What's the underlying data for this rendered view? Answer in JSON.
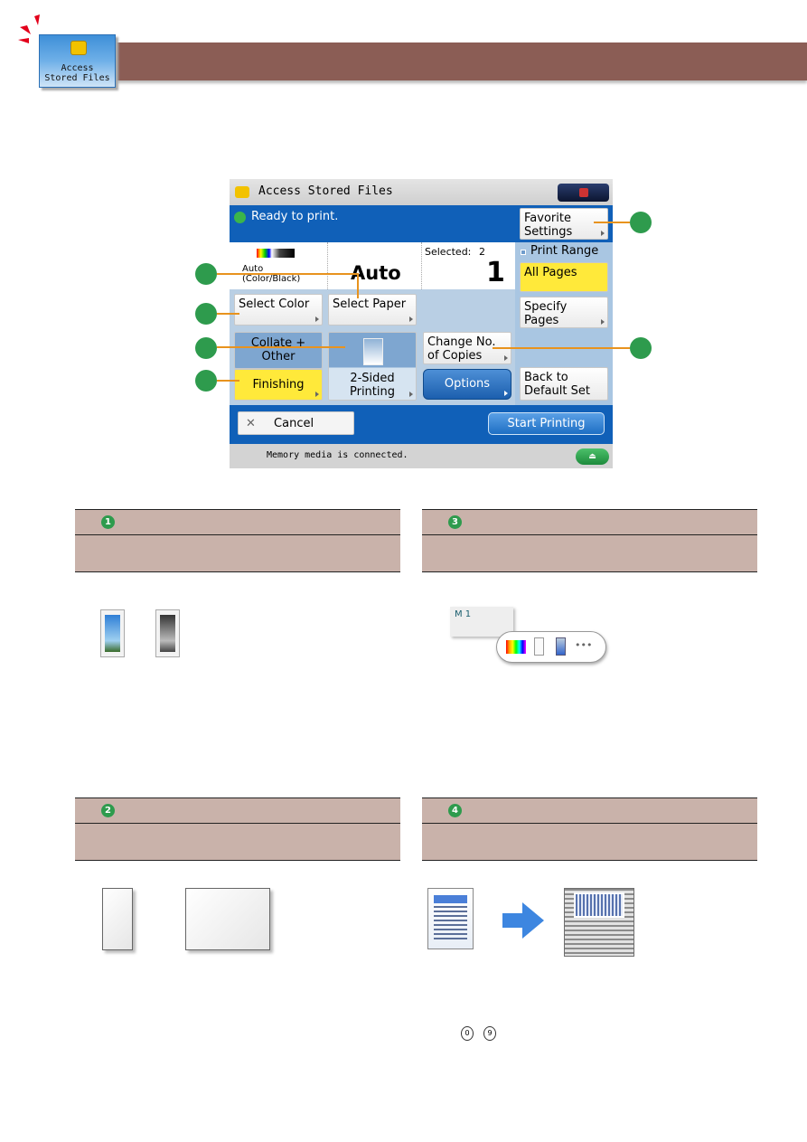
{
  "header": {
    "tile_label_line1": "Access",
    "tile_label_line2": "Stored Files"
  },
  "screen": {
    "title": "Access Stored Files",
    "status": "Ready to print.",
    "favorite_settings": [
      "Favorite",
      "Settings"
    ],
    "color_mode": [
      "Auto",
      "(Color/Black)"
    ],
    "paper": "Auto",
    "selected_label": "Selected:",
    "selected_count": "2",
    "copies": "1",
    "print_range_label": "Print Range",
    "all_pages": "All Pages",
    "specify_pages": [
      "Specify",
      "Pages"
    ],
    "select_color": "Select Color",
    "select_paper": "Select Paper",
    "collate": [
      "Collate +",
      "Other"
    ],
    "finishing": "Finishing",
    "two_sided": [
      "2-Sided",
      "Printing"
    ],
    "change_copies": [
      "Change No.",
      "of Copies"
    ],
    "options": "Options",
    "back_default": [
      "Back to",
      "Default Set"
    ],
    "cancel": "Cancel",
    "start_printing": "Start Printing",
    "footer_status": "Memory media is connected."
  },
  "sections": [
    {
      "num": "1"
    },
    {
      "num": "3"
    },
    {
      "num": "2"
    },
    {
      "num": "4"
    }
  ],
  "mode_popup": {
    "label": "M 1",
    "more": "•••"
  },
  "keys": [
    "0",
    "9"
  ],
  "colors": {
    "brown": "#8b5d55",
    "table": "#c9b2aa",
    "screen_blue": "#1060b8",
    "highlight": "#ffe93a",
    "callout": "#2e9b4d",
    "leader": "#e8931e"
  }
}
